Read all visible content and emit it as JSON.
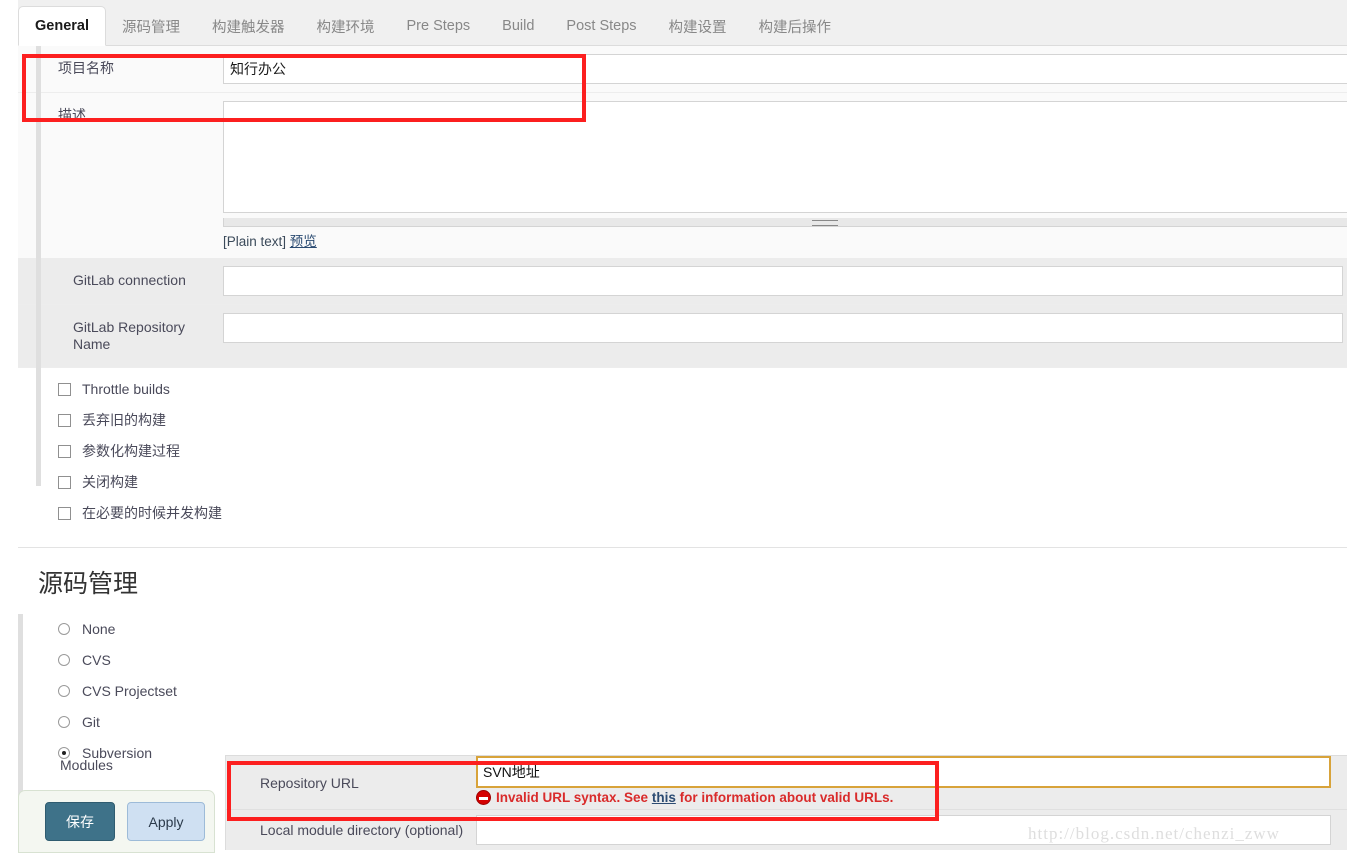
{
  "tabs": [
    {
      "label": "General",
      "active": true
    },
    {
      "label": "源码管理",
      "active": false
    },
    {
      "label": "构建触发器",
      "active": false
    },
    {
      "label": "构建环境",
      "active": false
    },
    {
      "label": "Pre Steps",
      "active": false
    },
    {
      "label": "Build",
      "active": false
    },
    {
      "label": "Post Steps",
      "active": false
    },
    {
      "label": "构建设置",
      "active": false
    },
    {
      "label": "构建后操作",
      "active": false
    }
  ],
  "general": {
    "project_name_label": "项目名称",
    "project_name_value": "知行办公",
    "description_label": "描述",
    "description_value": "",
    "markup_format": "[Plain text]",
    "preview_link": "预览",
    "gitlab_connection_label": "GitLab connection",
    "gitlab_connection_value": "",
    "gitlab_repo_label": "GitLab Repository Name",
    "gitlab_repo_value": ""
  },
  "checkboxes": [
    {
      "label": "Throttle builds",
      "checked": false
    },
    {
      "label": "丢弃旧的构建",
      "checked": false
    },
    {
      "label": "参数化构建过程",
      "checked": false
    },
    {
      "label": "关闭构建",
      "checked": false
    },
    {
      "label": "在必要的时候并发构建",
      "checked": false
    }
  ],
  "scm": {
    "heading": "源码管理",
    "options": [
      {
        "label": "None",
        "selected": false
      },
      {
        "label": "CVS",
        "selected": false
      },
      {
        "label": "CVS Projectset",
        "selected": false
      },
      {
        "label": "Git",
        "selected": false
      },
      {
        "label": "Subversion",
        "selected": true
      }
    ],
    "modules_label": "Modules",
    "repository_url_label": "Repository URL",
    "repository_url_value": "SVN地址",
    "error_text_before": "Invalid URL syntax. See",
    "error_link": "this",
    "error_text_after": "for information about valid URLs.",
    "local_module_label": "Local module directory (optional)",
    "local_module_value": ""
  },
  "footer": {
    "save_label": "保存",
    "apply_label": "Apply"
  },
  "watermark": "http://blog.csdn.net/chenzi_zww",
  "colors": {
    "accent_save": "#3e7289",
    "accent_apply": "#cfe0f2",
    "error_red": "#d92b2b",
    "annotation_red": "#fc1f1f",
    "focus_border": "#d8a33a"
  }
}
